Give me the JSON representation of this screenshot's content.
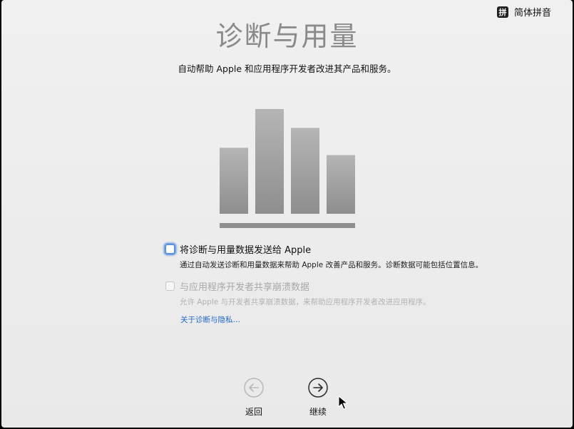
{
  "input_method": {
    "badge": "拼",
    "label": "简体拼音"
  },
  "page": {
    "title": "诊断与用量",
    "subtitle": "自动帮助 Apple 和应用程序开发者改进其产品和服务。"
  },
  "illustration": {
    "bar_levels": [
      0.63,
      1.0,
      0.82,
      0.56
    ]
  },
  "options": [
    {
      "label": "将诊断与用量数据发送给 Apple",
      "description": "通过自动发送诊断和用量数据来帮助 Apple 改善产品和服务。诊断数据可能包括位置信息。",
      "checked": false,
      "enabled": true
    },
    {
      "label": "与应用程序开发者共享崩溃数据",
      "description": "允许 Apple 与开发者共享崩溃数据，来帮助应用程序开发者改进应用程序。",
      "checked": false,
      "enabled": false
    }
  ],
  "privacy_link": "关于诊断与隐私…",
  "nav": {
    "back_label": "返回",
    "continue_label": "继续"
  },
  "colors": {
    "link": "#1e66c8",
    "title": "#8a8a8a",
    "focus_ring": "#6ea0e8"
  }
}
